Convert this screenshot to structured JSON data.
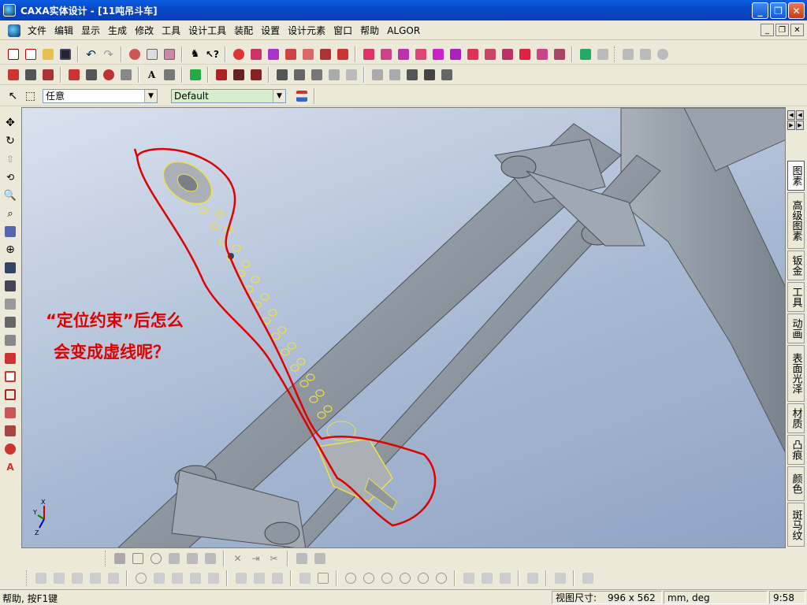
{
  "window": {
    "title": "CAXA实体设计 - [11吨吊斗车]",
    "buttons": [
      "minimize",
      "restore",
      "close"
    ]
  },
  "menubar": {
    "items": [
      "文件",
      "编辑",
      "显示",
      "生成",
      "修改",
      "工具",
      "设计工具",
      "装配",
      "设置",
      "设计元素",
      "窗口",
      "帮助",
      "ALGOR"
    ]
  },
  "toolbar3": {
    "filter_value": "任意",
    "style_value": "Default"
  },
  "right_tabs": {
    "items": [
      "图素",
      "高级图素",
      "钣金",
      "工具",
      "动画",
      "表面光泽",
      "材质",
      "凸痕",
      "颜色",
      "斑马纹"
    ],
    "active": "图素"
  },
  "viewport": {
    "annotation_line1": "“定位约束”后怎么",
    "annotation_line2": "会变成虚线呢？",
    "axis_labels": {
      "x": "X",
      "y": "Y",
      "z": "Z"
    }
  },
  "statusbar": {
    "help_text": "帮助, 按F1键",
    "viewsize_label": "视图尺寸:",
    "viewsize_value": "996 x 562",
    "units": "mm, deg",
    "time": "9:58"
  },
  "colors": {
    "titlebar": "#0a47c8",
    "annotation": "#e00000",
    "selection_highlight": "#f0e040",
    "model_grey": "#9aa3ad"
  }
}
